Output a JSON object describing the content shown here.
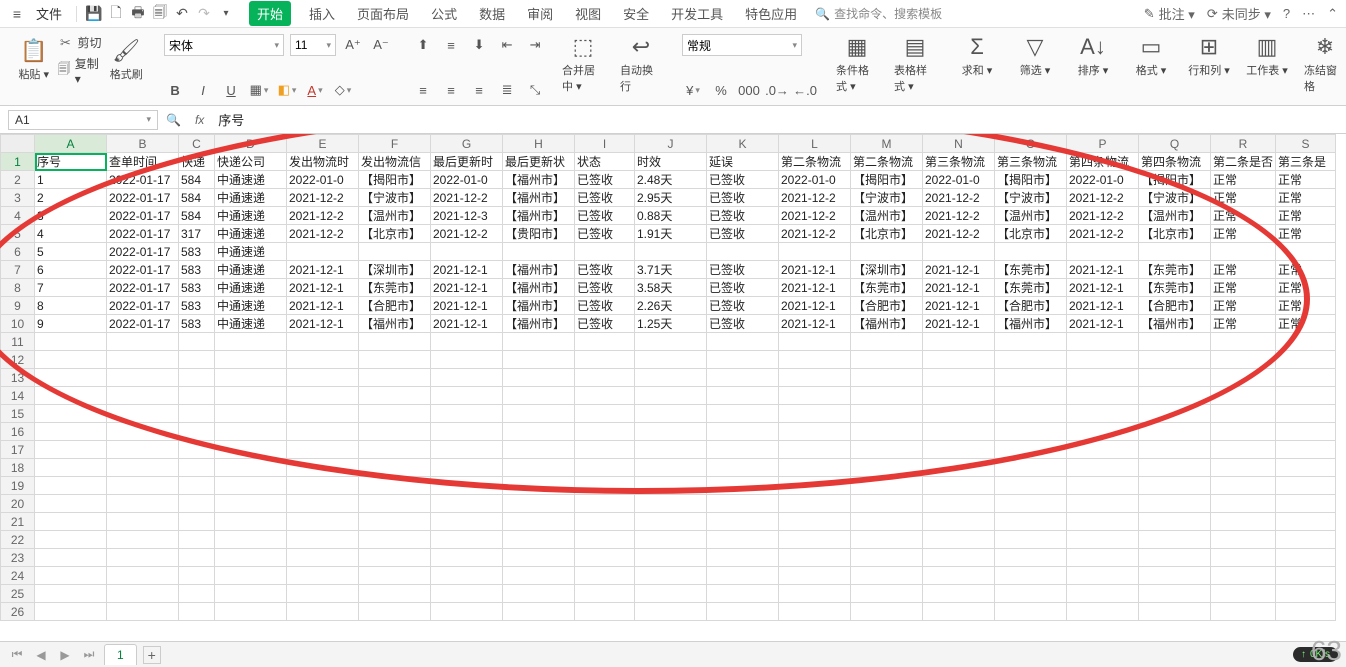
{
  "menubar": {
    "file": "文件",
    "tabs": [
      "开始",
      "插入",
      "页面布局",
      "公式",
      "数据",
      "审阅",
      "视图",
      "安全",
      "开发工具",
      "特色应用"
    ],
    "active_tab_index": 0,
    "search_placeholder": "查找命令、搜索模板",
    "right": {
      "annotate": "批注 ▾",
      "sync": "未同步 ▾"
    }
  },
  "ribbon": {
    "paste": "粘贴 ▾",
    "cut": "剪切",
    "copy": "复制 ▾",
    "fmtpaint": "格式刷",
    "font_name": "宋体",
    "font_size": "11",
    "merge": "合并居中 ▾",
    "wrap": "自动换行",
    "numfmt": "常规",
    "condfmt": "条件格式 ▾",
    "tablestyle": "表格样式 ▾",
    "sum": "求和 ▾",
    "filter": "筛选 ▾",
    "sort": "排序 ▾",
    "format": "格式 ▾",
    "rowcol": "行和列 ▾",
    "worksheet": "工作表 ▾",
    "freeze": "冻结窗格"
  },
  "namebox": "A1",
  "formula_value": "序号",
  "columns": [
    "A",
    "B",
    "C",
    "D",
    "E",
    "F",
    "G",
    "H",
    "I",
    "J",
    "K",
    "L",
    "M",
    "N",
    "O",
    "P",
    "Q",
    "R",
    "S"
  ],
  "col_classes": [
    "cA",
    "cB",
    "cC",
    "cD",
    "cE",
    "cF",
    "cG",
    "cH",
    "cI",
    "cJ",
    "cK",
    "cL",
    "cM",
    "cN",
    "cO",
    "cP",
    "cQ",
    "cR",
    "cS"
  ],
  "header_row": [
    "序号",
    "查单时间",
    "快递",
    "快递公司",
    "发出物流时",
    "发出物流信",
    "最后更新时",
    "最后更新状",
    "状态",
    "时效",
    "延误",
    "第二条物流",
    "第二条物流",
    "第三条物流",
    "第三条物流",
    "第四条物流",
    "第四条物流",
    "第二条是否",
    "第三条是"
  ],
  "data_rows": [
    [
      "1",
      "2022-01-17",
      "584",
      "中通速递",
      "2022-01-0",
      "【揭阳市】",
      "2022-01-0",
      "【福州市】",
      "已签收",
      "2.48天",
      "已签收",
      "2022-01-0",
      "【揭阳市】",
      "2022-01-0",
      "【揭阳市】",
      "2022-01-0",
      "【揭阳市】",
      "正常",
      "正常"
    ],
    [
      "2",
      "2022-01-17",
      "584",
      "中通速递",
      "2021-12-2",
      "【宁波市】",
      "2021-12-2",
      "【福州市】",
      "已签收",
      "2.95天",
      "已签收",
      "2021-12-2",
      "【宁波市】",
      "2021-12-2",
      "【宁波市】",
      "2021-12-2",
      "【宁波市】",
      "正常",
      "正常"
    ],
    [
      "3",
      "2022-01-17",
      "584",
      "中通速递",
      "2021-12-2",
      "【温州市】",
      "2021-12-3",
      "【福州市】",
      "已签收",
      "0.88天",
      "已签收",
      "2021-12-2",
      "【温州市】",
      "2021-12-2",
      "【温州市】",
      "2021-12-2",
      "【温州市】",
      "正常",
      "正常"
    ],
    [
      "4",
      "2022-01-17",
      "317",
      "中通速递",
      "2021-12-2",
      "【北京市】",
      "2021-12-2",
      "【贵阳市】",
      "已签收",
      "1.91天",
      "已签收",
      "2021-12-2",
      "【北京市】",
      "2021-12-2",
      "【北京市】",
      "2021-12-2",
      "【北京市】",
      "正常",
      "正常"
    ],
    [
      "5",
      "2022-01-17",
      "583",
      "中通速递",
      "",
      "",
      "",
      "",
      "",
      "",
      "",
      "",
      "",
      "",
      "",
      "",
      "",
      "",
      ""
    ],
    [
      "6",
      "2022-01-17",
      "583",
      "中通速递",
      "2021-12-1",
      "【深圳市】",
      "2021-12-1",
      "【福州市】",
      "已签收",
      "3.71天",
      "已签收",
      "2021-12-1",
      "【深圳市】",
      "2021-12-1",
      "【东莞市】",
      "2021-12-1",
      "【东莞市】",
      "正常",
      "正常"
    ],
    [
      "7",
      "2022-01-17",
      "583",
      "中通速递",
      "2021-12-1",
      "【东莞市】",
      "2021-12-1",
      "【福州市】",
      "已签收",
      "3.58天",
      "已签收",
      "2021-12-1",
      "【东莞市】",
      "2021-12-1",
      "【东莞市】",
      "2021-12-1",
      "【东莞市】",
      "正常",
      "正常"
    ],
    [
      "8",
      "2022-01-17",
      "583",
      "中通速递",
      "2021-12-1",
      "【合肥市】",
      "2021-12-1",
      "【福州市】",
      "已签收",
      "2.26天",
      "已签收",
      "2021-12-1",
      "【合肥市】",
      "2021-12-1",
      "【合肥市】",
      "2021-12-1",
      "【合肥市】",
      "正常",
      "正常"
    ],
    [
      "9",
      "2022-01-17",
      "583",
      "中通速递",
      "2021-12-1",
      "【福州市】",
      "2021-12-1",
      "【福州市】",
      "已签收",
      "1.25天",
      "已签收",
      "2021-12-1",
      "【福州市】",
      "2021-12-1",
      "【福州市】",
      "2021-12-1",
      "【福州市】",
      "正常",
      "正常"
    ]
  ],
  "total_rows": 26,
  "sheet_tab": "1",
  "status": {
    "net": "0K/s",
    "bignum": "63"
  }
}
